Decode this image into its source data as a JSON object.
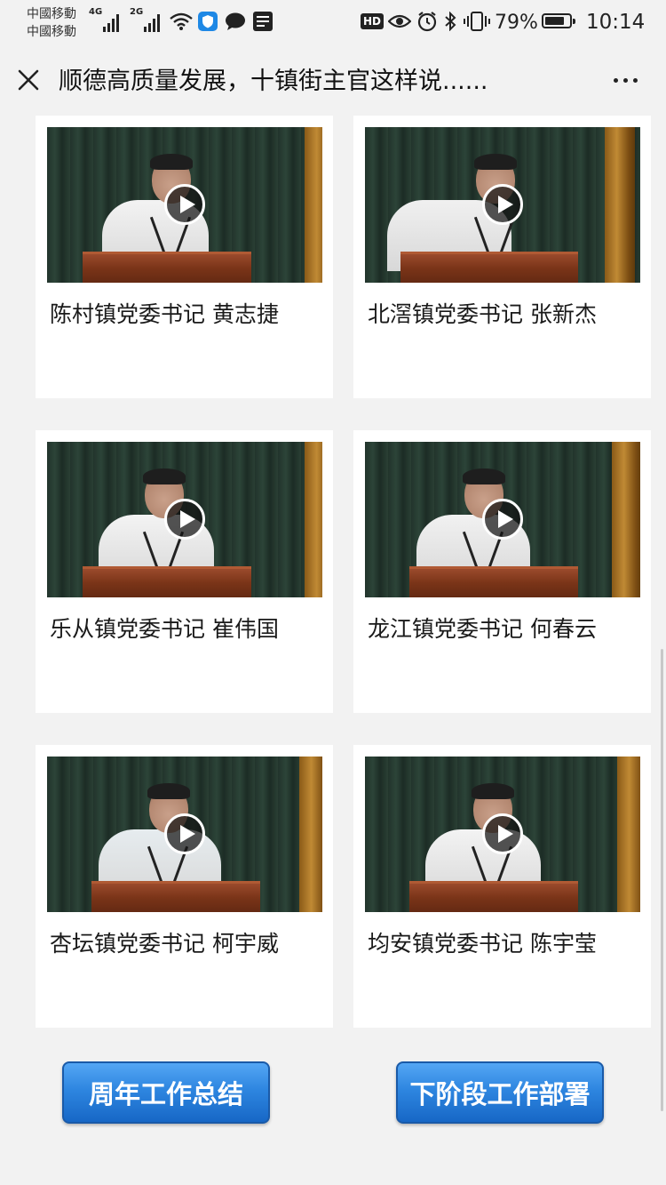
{
  "status_bar": {
    "carrier_1": "中國移動",
    "carrier_2": "中國移動",
    "sim1_network": "4G",
    "sim2_network": "2G",
    "hd_label": "HD",
    "battery_percent": "79%",
    "battery_level": 0.79,
    "time": "10:14",
    "icons": [
      "signal-icon",
      "wifi-icon",
      "shield-app-icon",
      "chat-icon",
      "news-app-icon",
      "eye-comfort-icon",
      "alarm-icon",
      "bluetooth-icon",
      "vibrate-icon",
      "battery-icon"
    ]
  },
  "nav": {
    "title": "顺德高质量发展，十镇街主官这样说......"
  },
  "videos": [
    {
      "caption": "陈村镇党委书记 黄志捷"
    },
    {
      "caption": "北滘镇党委书记 张新杰"
    },
    {
      "caption": "乐从镇党委书记 崔伟国"
    },
    {
      "caption": "龙江镇党委书记 何春云"
    },
    {
      "caption": "杏坛镇党委书记 柯宇威"
    },
    {
      "caption": "均安镇党委书记 陈宇莹"
    }
  ],
  "buttons": {
    "annual_summary": "周年工作总结",
    "next_stage": "下阶段工作部署"
  },
  "colors": {
    "background": "#f2f2f2",
    "button_blue": "#2e86e0"
  }
}
